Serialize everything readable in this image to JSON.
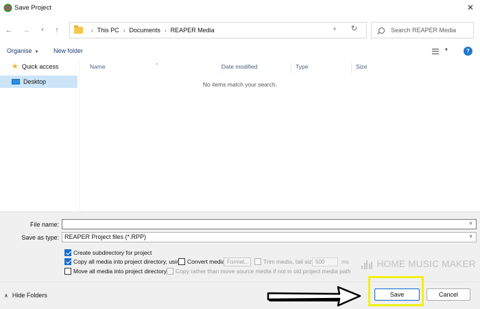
{
  "window": {
    "title": "Save Project",
    "close_glyph": "✕",
    "app_icon": "reaper-logo-icon"
  },
  "address": {
    "breadcrumbs": [
      "This PC",
      "Documents",
      "REAPER Media"
    ],
    "separator": "›",
    "search_placeholder": "Search REAPER Media"
  },
  "toolbar": {
    "organise": "Organise",
    "new_folder": "New folder",
    "help": "?"
  },
  "nav": {
    "items": [
      {
        "label": "Quick access",
        "icon": "star-icon"
      },
      {
        "label": "Desktop",
        "icon": "desktop-icon"
      }
    ]
  },
  "file_list": {
    "columns": [
      "Name",
      "Date modified",
      "Type",
      "Size"
    ],
    "empty_message": "No items match your search."
  },
  "form": {
    "file_name_label": "File name:",
    "file_name_value": "",
    "save_type_label": "Save as type:",
    "save_type_value": "REAPER Project files (*.RPP)"
  },
  "options": {
    "create_subdir": {
      "label": "Create subdirectory for project",
      "checked": true
    },
    "copy_all": {
      "label": "Copy all media into project directory, using:",
      "checked": true
    },
    "convert_media": {
      "label": "Convert media",
      "checked": false
    },
    "format_label": "Format...",
    "trim_media": {
      "label": "Trim media, tail size:",
      "checked": false,
      "disabled": true
    },
    "tail_size": "500",
    "tail_unit": "ms",
    "move_all": {
      "label": "Move all media into project directory",
      "checked": false
    },
    "copy_rather": {
      "label": "Copy rather than move source media if not in old project media path",
      "checked": false,
      "disabled": true
    }
  },
  "watermark": "HOME MUSIC MAKER",
  "footer": {
    "hide_folders": "Hide Folders",
    "save": "Save",
    "cancel": "Cancel"
  },
  "colors": {
    "accent": "#1a6fcf",
    "highlight": "#f3f00f",
    "selected_nav": "#cce4f7"
  }
}
